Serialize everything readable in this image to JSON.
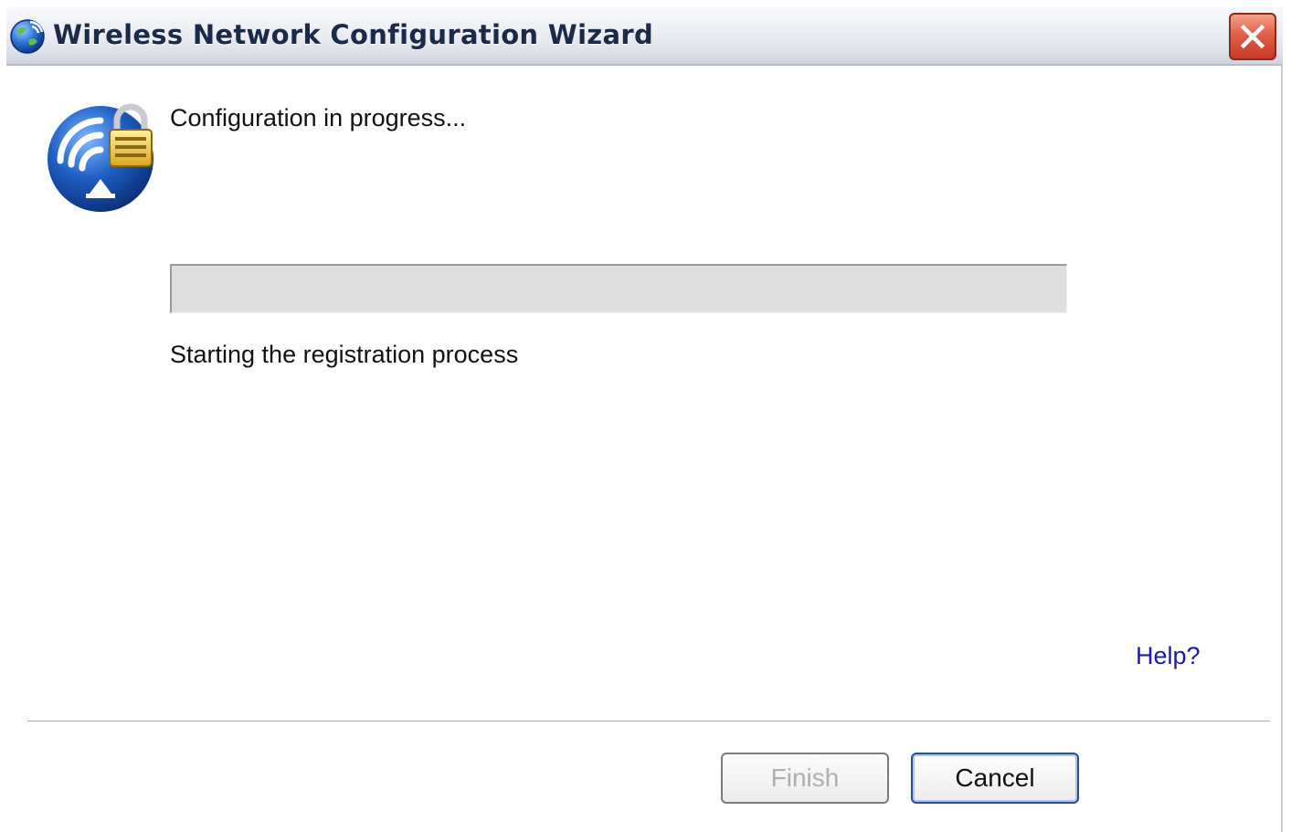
{
  "window": {
    "title": "Wireless Network Configuration Wizard",
    "close_label": "Close"
  },
  "main": {
    "heading": "Configuration in progress...",
    "status": "Starting the registration process",
    "progress_fraction": 0
  },
  "footer": {
    "help_label": "Help?",
    "finish_label": "Finish",
    "cancel_label": "Cancel",
    "finish_enabled": false
  },
  "icons": {
    "title_icon": "globe-wireless-icon",
    "wizard_icon": "wireless-lock-icon",
    "close_icon": "close-icon"
  },
  "colors": {
    "link": "#1a1aa6",
    "close_button": "#d64b33",
    "icon_blue": "#1f5fc4",
    "lock_gold": "#e8c02a"
  }
}
